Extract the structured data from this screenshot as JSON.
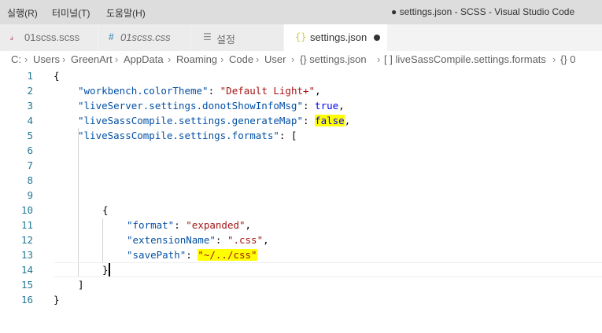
{
  "menu": {
    "items": [
      "실행(R)",
      "터미널(T)",
      "도움말(H)"
    ]
  },
  "window": {
    "title": "● settings.json - SCSS - Visual Studio Code"
  },
  "tabs": [
    {
      "label": "01scss.scss",
      "icon": "scss-file-icon",
      "active": false
    },
    {
      "label": "01scss.css",
      "icon": "hash-icon",
      "active": false
    },
    {
      "label": "설정",
      "icon": "settings-list-icon",
      "active": false
    },
    {
      "label": "settings.json",
      "icon": "json-braces-icon",
      "active": true,
      "dirty": true
    }
  ],
  "breadcrumb": [
    "C:",
    "Users",
    "GreenArt",
    "AppData",
    "Roaming",
    "Code",
    "User",
    "{} settings.json",
    "[ ] liveSassCompile.settings.formats",
    "{} 0"
  ],
  "editor": {
    "current_line": 14,
    "lines": [
      {
        "n": "1",
        "tokens": [
          {
            "t": "{",
            "c": "punct"
          }
        ]
      },
      {
        "n": "2",
        "tokens": [
          {
            "t": "\"workbench.colorTheme\"",
            "c": "key"
          },
          {
            "t": ": ",
            "c": "punct"
          },
          {
            "t": "\"Default Light+\"",
            "c": "str"
          },
          {
            "t": ",",
            "c": "punct"
          }
        ]
      },
      {
        "n": "3",
        "tokens": [
          {
            "t": "\"liveServer.settings.donotShowInfoMsg\"",
            "c": "key"
          },
          {
            "t": ": ",
            "c": "punct"
          },
          {
            "t": "true",
            "c": "bool"
          },
          {
            "t": ",",
            "c": "punct"
          }
        ]
      },
      {
        "n": "4",
        "tokens": [
          {
            "t": "\"liveSassCompile.settings.generateMap\"",
            "c": "key"
          },
          {
            "t": ": ",
            "c": "punct"
          },
          {
            "t": "false",
            "c": "bool hl"
          },
          {
            "t": ",",
            "c": "punct"
          }
        ]
      },
      {
        "n": "5",
        "tokens": [
          {
            "t": "\"liveSassCompile.settings.formats\"",
            "c": "key"
          },
          {
            "t": ": [",
            "c": "punct"
          }
        ]
      },
      {
        "n": "6",
        "tokens": []
      },
      {
        "n": "7",
        "tokens": []
      },
      {
        "n": "8",
        "tokens": []
      },
      {
        "n": "9",
        "tokens": []
      },
      {
        "n": "10",
        "tokens": [
          {
            "t": "{",
            "c": "punct"
          }
        ]
      },
      {
        "n": "11",
        "tokens": [
          {
            "t": "\"format\"",
            "c": "key"
          },
          {
            "t": ": ",
            "c": "punct"
          },
          {
            "t": "\"expanded\"",
            "c": "str"
          },
          {
            "t": ",",
            "c": "punct"
          }
        ]
      },
      {
        "n": "12",
        "tokens": [
          {
            "t": "\"extensionName\"",
            "c": "key"
          },
          {
            "t": ": ",
            "c": "punct"
          },
          {
            "t": "\".css\"",
            "c": "str"
          },
          {
            "t": ",",
            "c": "punct"
          }
        ]
      },
      {
        "n": "13",
        "tokens": [
          {
            "t": "\"savePath\"",
            "c": "key"
          },
          {
            "t": ": ",
            "c": "punct"
          },
          {
            "t": "\"~/../css\"",
            "c": "str hl"
          }
        ]
      },
      {
        "n": "14",
        "tokens": [
          {
            "t": "}",
            "c": "punct"
          }
        ]
      },
      {
        "n": "15",
        "tokens": [
          {
            "t": "]",
            "c": "punct"
          }
        ]
      },
      {
        "n": "16",
        "tokens": [
          {
            "t": "}",
            "c": "punct"
          }
        ]
      }
    ]
  },
  "colors": {
    "key": "#0451a5",
    "string": "#a31515",
    "keyword": "#0000ff",
    "line_number": "#237893",
    "highlight": "#ffff00"
  }
}
